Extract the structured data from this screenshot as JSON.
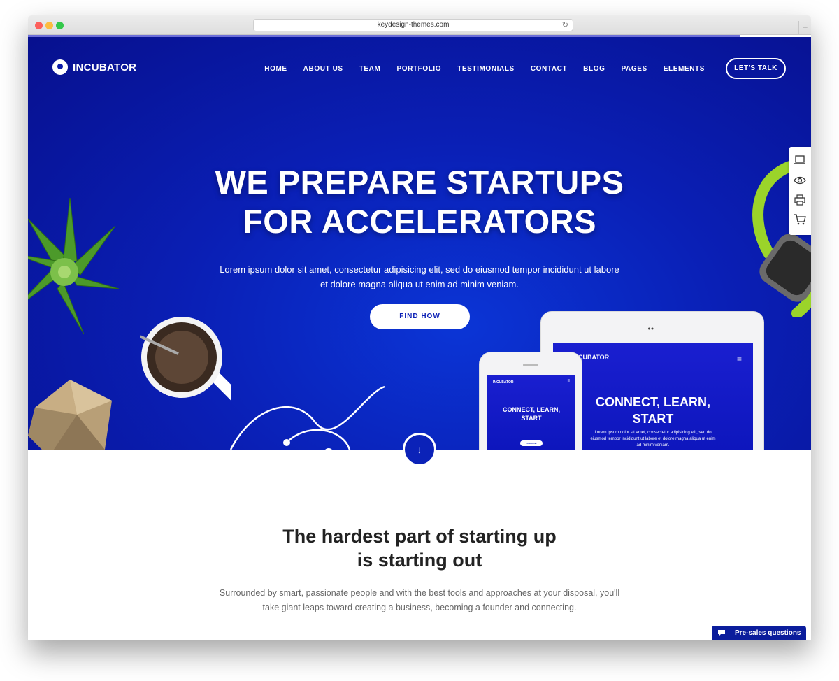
{
  "browser": {
    "url": "keydesign-themes.com"
  },
  "header": {
    "logo_text": "INCUBATOR",
    "nav": [
      "HOME",
      "ABOUT US",
      "TEAM",
      "PORTFOLIO",
      "TESTIMONIALS",
      "CONTACT",
      "BLOG",
      "PAGES",
      "ELEMENTS"
    ],
    "cta_label": "LET'S TALK"
  },
  "hero": {
    "title_line1": "WE PREPARE STARTUPS",
    "title_line2": "FOR ACCELERATORS",
    "lead_line1": "Lorem ipsum dolor sit amet, consectetur adipisicing elit, sed do eiusmod tempor incididunt ut labore",
    "lead_line2": "et dolore magna aliqua ut enim ad minim veniam.",
    "button_label": "FIND HOW"
  },
  "devices": {
    "tablet_logo": "INCUBATOR",
    "tablet_title_line1": "CONNECT, LEARN,",
    "tablet_title_line2": "START",
    "tablet_text": "Lorem ipsum dolor sit amet, consectetur adipisicing elit, sed do eiusmod tempor incididunt ut labore et dolore magna aliqua ut enim ad minim veniam.",
    "phone_logo": "INCUBATOR",
    "phone_title_line1": "CONNECT, LEARN,",
    "phone_title_line2": "START",
    "phone_button": "FIND HOW"
  },
  "side_tools": [
    "laptop-icon",
    "eye-icon",
    "printer-icon",
    "cart-icon"
  ],
  "scroll_arrow": "↓",
  "section": {
    "title_line1": "The hardest part of starting up",
    "title_line2": "is starting out",
    "text_line1": "Surrounded by smart, passionate people and with the best tools and approaches at your disposal, you'll",
    "text_line2": "take giant leaps toward creating a business, becoming a founder and connecting."
  },
  "chat": {
    "label": "Pre-sales questions"
  },
  "colors": {
    "brand_blue": "#0a1fb5",
    "loadbar": "#6d6fd9"
  }
}
